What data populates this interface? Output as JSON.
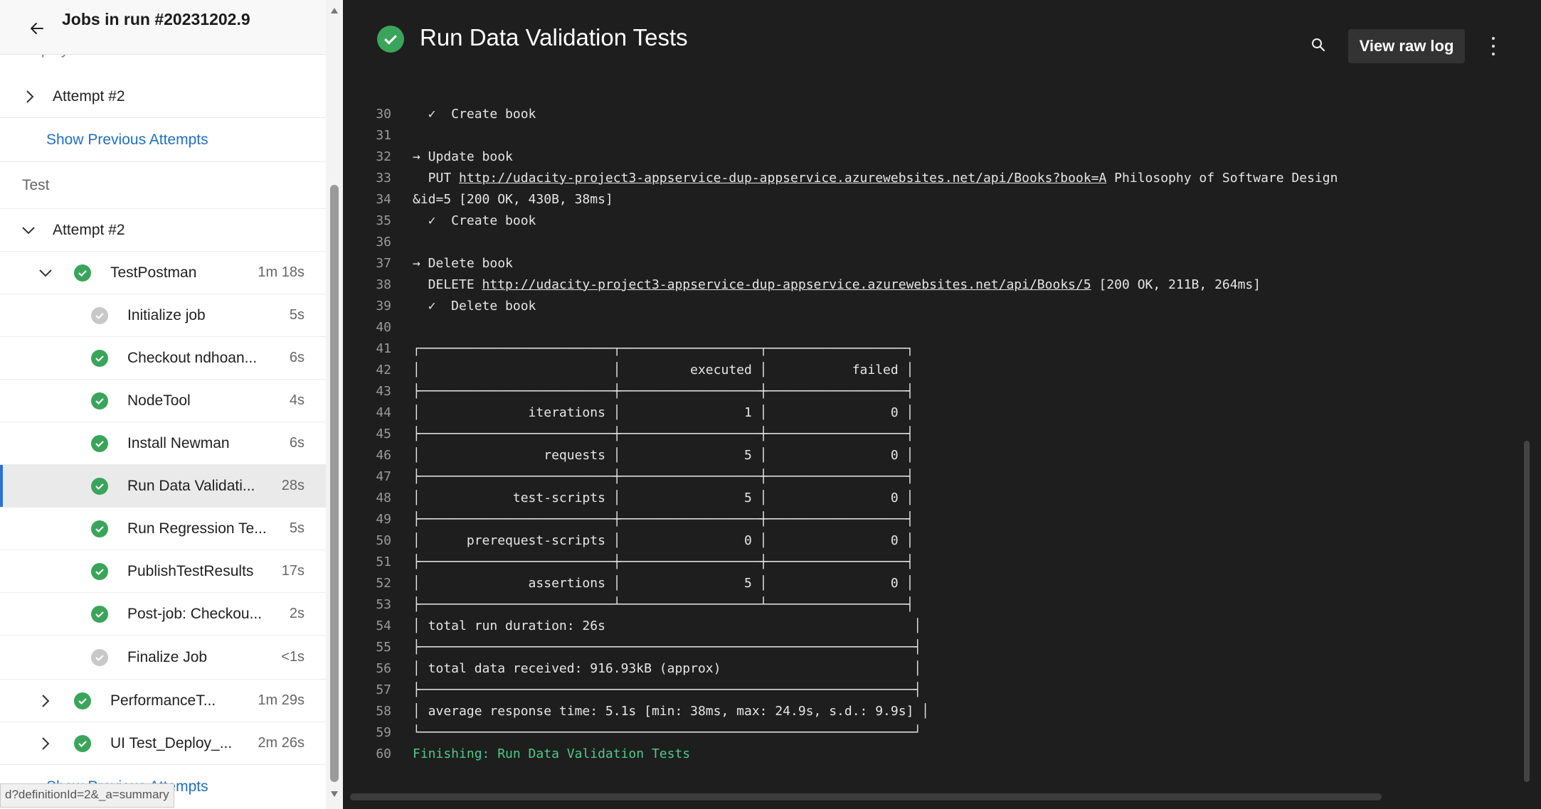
{
  "left": {
    "title": "Jobs in run #20231202.9",
    "deploy_peek": "Deploy",
    "deploy_attempt": "Attempt #2",
    "show_previous_top": "Show Previous Attempts",
    "test_stage": "Test",
    "test_attempt": "Attempt #2",
    "job": {
      "name": "TestPostman",
      "duration": "1m 18s"
    },
    "steps": [
      {
        "name": "Initialize job",
        "duration": "5s",
        "status": "skipped"
      },
      {
        "name": "Checkout ndhoan...",
        "duration": "6s",
        "status": "success"
      },
      {
        "name": "NodeTool",
        "duration": "4s",
        "status": "success"
      },
      {
        "name": "Install Newman",
        "duration": "6s",
        "status": "success"
      },
      {
        "name": "Run Data Validati...",
        "duration": "28s",
        "status": "success"
      },
      {
        "name": "Run Regression Te...",
        "duration": "5s",
        "status": "success"
      },
      {
        "name": "PublishTestResults",
        "duration": "17s",
        "status": "success"
      },
      {
        "name": "Post-job: Checkou...",
        "duration": "2s",
        "status": "success"
      },
      {
        "name": "Finalize Job",
        "duration": "<1s",
        "status": "skipped"
      }
    ],
    "other_jobs": [
      {
        "name": "PerformanceT...",
        "duration": "1m 29s"
      },
      {
        "name": "UI Test_Deploy_...",
        "duration": "2m 26s"
      }
    ],
    "show_previous_bottom": "Show Previous Attempts",
    "url_tooltip": "d?definitionId=2&_a=summary"
  },
  "right": {
    "title": "Run Data Validation Tests",
    "view_raw_log": "View raw log",
    "log_lines": [
      {
        "n": "30",
        "t": "  ✓  Create book"
      },
      {
        "n": "31",
        "t": ""
      },
      {
        "n": "32",
        "t": "→ Update book"
      },
      {
        "n": "33",
        "t": "  PUT ",
        "link": "http://udacity-project3-appservice-dup-appservice.azurewebsites.net/api/Books?book=A",
        "tail": " Philosophy of Software Design"
      },
      {
        "n": "34",
        "t": "&id=5 [200 OK, 430B, 38ms]"
      },
      {
        "n": "35",
        "t": "  ✓  Create book"
      },
      {
        "n": "36",
        "t": ""
      },
      {
        "n": "37",
        "t": "→ Delete book"
      },
      {
        "n": "38",
        "t": "  DELETE ",
        "link": "http://udacity-project3-appservice-dup-appservice.azurewebsites.net/api/Books/5",
        "tail": " [200 OK, 211B, 264ms]"
      },
      {
        "n": "39",
        "t": "  ✓  Delete book"
      },
      {
        "n": "40",
        "t": ""
      },
      {
        "n": "41",
        "t": "┌─────────────────────────┬──────────────────┬──────────────────┐"
      },
      {
        "n": "42",
        "t": "│                         │         executed │           failed │"
      },
      {
        "n": "43",
        "t": "├─────────────────────────┼──────────────────┼──────────────────┤"
      },
      {
        "n": "44",
        "t": "│              iterations │                1 │                0 │"
      },
      {
        "n": "45",
        "t": "├─────────────────────────┼──────────────────┼──────────────────┤"
      },
      {
        "n": "46",
        "t": "│                requests │                5 │                0 │"
      },
      {
        "n": "47",
        "t": "├─────────────────────────┼──────────────────┼──────────────────┤"
      },
      {
        "n": "48",
        "t": "│            test-scripts │                5 │                0 │"
      },
      {
        "n": "49",
        "t": "├─────────────────────────┼──────────────────┼──────────────────┤"
      },
      {
        "n": "50",
        "t": "│      prerequest-scripts │                0 │                0 │"
      },
      {
        "n": "51",
        "t": "├─────────────────────────┼──────────────────┼──────────────────┤"
      },
      {
        "n": "52",
        "t": "│              assertions │                5 │                0 │"
      },
      {
        "n": "53",
        "t": "├─────────────────────────┴──────────────────┴──────────────────┤"
      },
      {
        "n": "54",
        "t": "│ total run duration: 26s                                        │"
      },
      {
        "n": "55",
        "t": "├────────────────────────────────────────────────────────────────┤"
      },
      {
        "n": "56",
        "t": "│ total data received: 916.93kB (approx)                         │"
      },
      {
        "n": "57",
        "t": "├────────────────────────────────────────────────────────────────┤"
      },
      {
        "n": "58",
        "t": "│ average response time: 5.1s [min: 38ms, max: 24.9s, s.d.: 9.9s] │"
      },
      {
        "n": "59",
        "t": "└────────────────────────────────────────────────────────────────┘"
      },
      {
        "n": "60",
        "t": "Finishing: Run Data Validation Tests",
        "finish": true
      }
    ]
  },
  "icons": {
    "back": "arrow-left-icon",
    "chevron_right": "chevron-right-icon",
    "chevron_down": "chevron-down-icon",
    "check": "check-circle-icon",
    "search": "search-icon",
    "more": "more-vertical-icon"
  },
  "colors": {
    "success": "#3aa55a",
    "skipped": "#c8c8c8",
    "link": "#1f6fc5",
    "selected_accent": "#2c6fd6",
    "log_bg": "#1e1e1e",
    "finish_text": "#4ec98a"
  }
}
